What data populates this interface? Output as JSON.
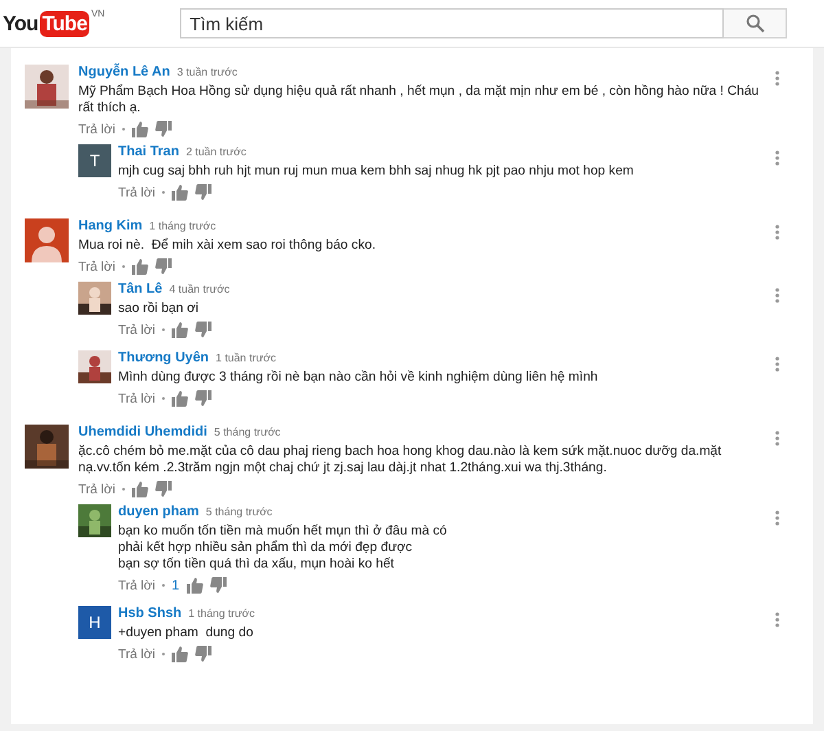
{
  "header": {
    "logo": {
      "you": "You",
      "tube": "Tube"
    },
    "region": "VN",
    "search": {
      "placeholder": "Tìm kiếm"
    }
  },
  "comments": [
    {
      "author": "Nguyễn Lê An",
      "time": "3 tuần trước",
      "avatar": {
        "kind": "picture"
      },
      "lines": [
        "Mỹ Phẩm Bạch Hoa Hồng sử dụng hiệu quả rất nhanh , hết mụn , da mặt mịn như em bé , còn hồng hào nữa ! Cháu rất thích ạ."
      ],
      "reply_label": "Trả lời",
      "replies": [
        {
          "author": "Thai Tran",
          "time": "2 tuần trước",
          "avatar": {
            "kind": "letter",
            "letter": "T",
            "color": "#455a64"
          },
          "lines": [
            "mjh cug saj bhh ruh hjt mun ruj mun mua kem bhh saj nhug hk pjt pao nhju mot hop kem"
          ],
          "reply_label": "Trả lời"
        }
      ]
    },
    {
      "author": "Hang Kim",
      "time": "1 tháng trước",
      "avatar": {
        "kind": "default"
      },
      "lines": [
        "Mua roi nè.  Để mih xài xem sao roi thông báo cko."
      ],
      "reply_label": "Trả lời",
      "replies": [
        {
          "author": "Tân Lê",
          "time": "4 tuần trước",
          "avatar": {
            "kind": "picture"
          },
          "lines": [
            "sao rồi bạn ơi"
          ],
          "reply_label": "Trả lời"
        },
        {
          "author": "Thương Uyên",
          "time": "1 tuần trước",
          "avatar": {
            "kind": "picture"
          },
          "lines": [
            "Mình dùng được 3 tháng rồi nè bạn nào cần hỏi về kinh nghiệm dùng liên hệ mình"
          ],
          "reply_label": "Trả lời"
        }
      ]
    },
    {
      "author": "Uhemdidi Uhemdidi",
      "time": "5 tháng trước",
      "avatar": {
        "kind": "picture"
      },
      "lines": [
        "ặc.cô chém bỏ me.mặt của cô dau phaj rieng bach hoa hong khog dau.nào là kem sứk mặt.nuoc dưỡg da.mặt nạ.vv.tốn kém .2.3trăm ngjn một chaj chứ jt zj.saj lau dàj.jt nhat 1.2tháng.xui wa thj.3tháng."
      ],
      "reply_label": "Trả lời",
      "replies": [
        {
          "author": "duyen pham",
          "time": "5 tháng trước",
          "avatar": {
            "kind": "picture"
          },
          "lines": [
            "bạn ko muốn tốn tiền mà muốn hết mụn thì ở đâu mà có",
            "phải kết hợp nhiều sản phẩm thì da mới đẹp được",
            "bạn sợ tốn tiền quá thì da xấu, mụn hoài ko hết"
          ],
          "reply_label": "Trả lời",
          "like_count": "1"
        },
        {
          "author": "Hsb Shsh",
          "time": "1 tháng trước",
          "avatar": {
            "kind": "letter",
            "letter": "H",
            "color": "#1e5aa8"
          },
          "lines": [
            "+duyen pham  dung do"
          ],
          "reply_label": "Trả lời"
        }
      ]
    }
  ]
}
